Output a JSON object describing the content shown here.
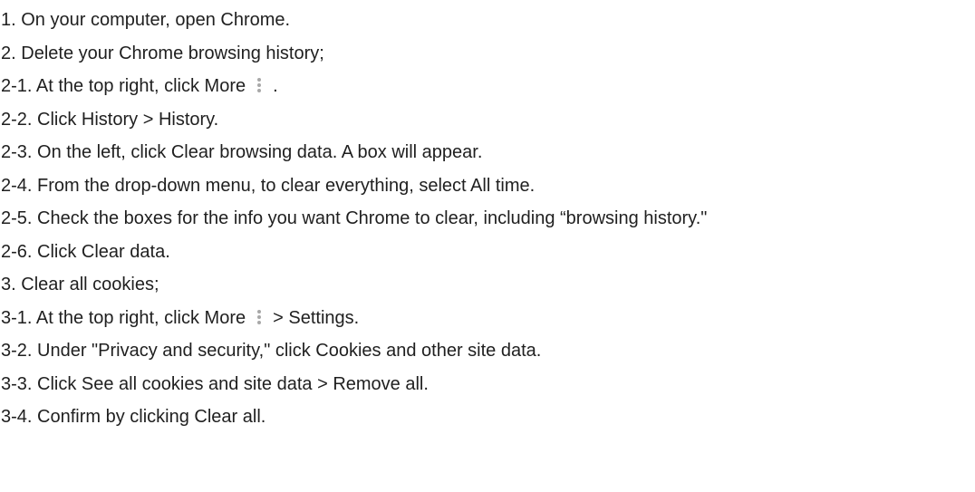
{
  "steps": [
    {
      "num": "1.",
      "text": "On your computer, open Chrome."
    },
    {
      "num": "2.",
      "text": "Delete your Chrome browsing history;"
    },
    {
      "num": "2-1.",
      "text": "At the top right, click More",
      "icon": "more-vert-icon",
      "after": "."
    },
    {
      "num": "2-2.",
      "text": "Click History > History."
    },
    {
      "num": "2-3.",
      "text": "On the left, click Clear browsing data. A box will appear."
    },
    {
      "num": "2-4.",
      "text": "From the drop-down menu, to clear everything, select All time."
    },
    {
      "num": "2-5.",
      "text": "Check the boxes for the info you want Chrome to clear, including “browsing history.\""
    },
    {
      "num": "2-6.",
      "text": "Click Clear data."
    },
    {
      "num": "3.",
      "text": "Clear all cookies;"
    },
    {
      "num": "3-1.",
      "text": "At the top right, click More",
      "icon": "more-vert-icon",
      "after": "> Settings."
    },
    {
      "num": "3-2.",
      "text": "Under \"Privacy and security,\" click Cookies and other site data."
    },
    {
      "num": "3-3.",
      "text": "Click See all cookies and site data > Remove all."
    },
    {
      "num": "3-4.",
      "text": "Confirm by clicking Clear all."
    }
  ]
}
